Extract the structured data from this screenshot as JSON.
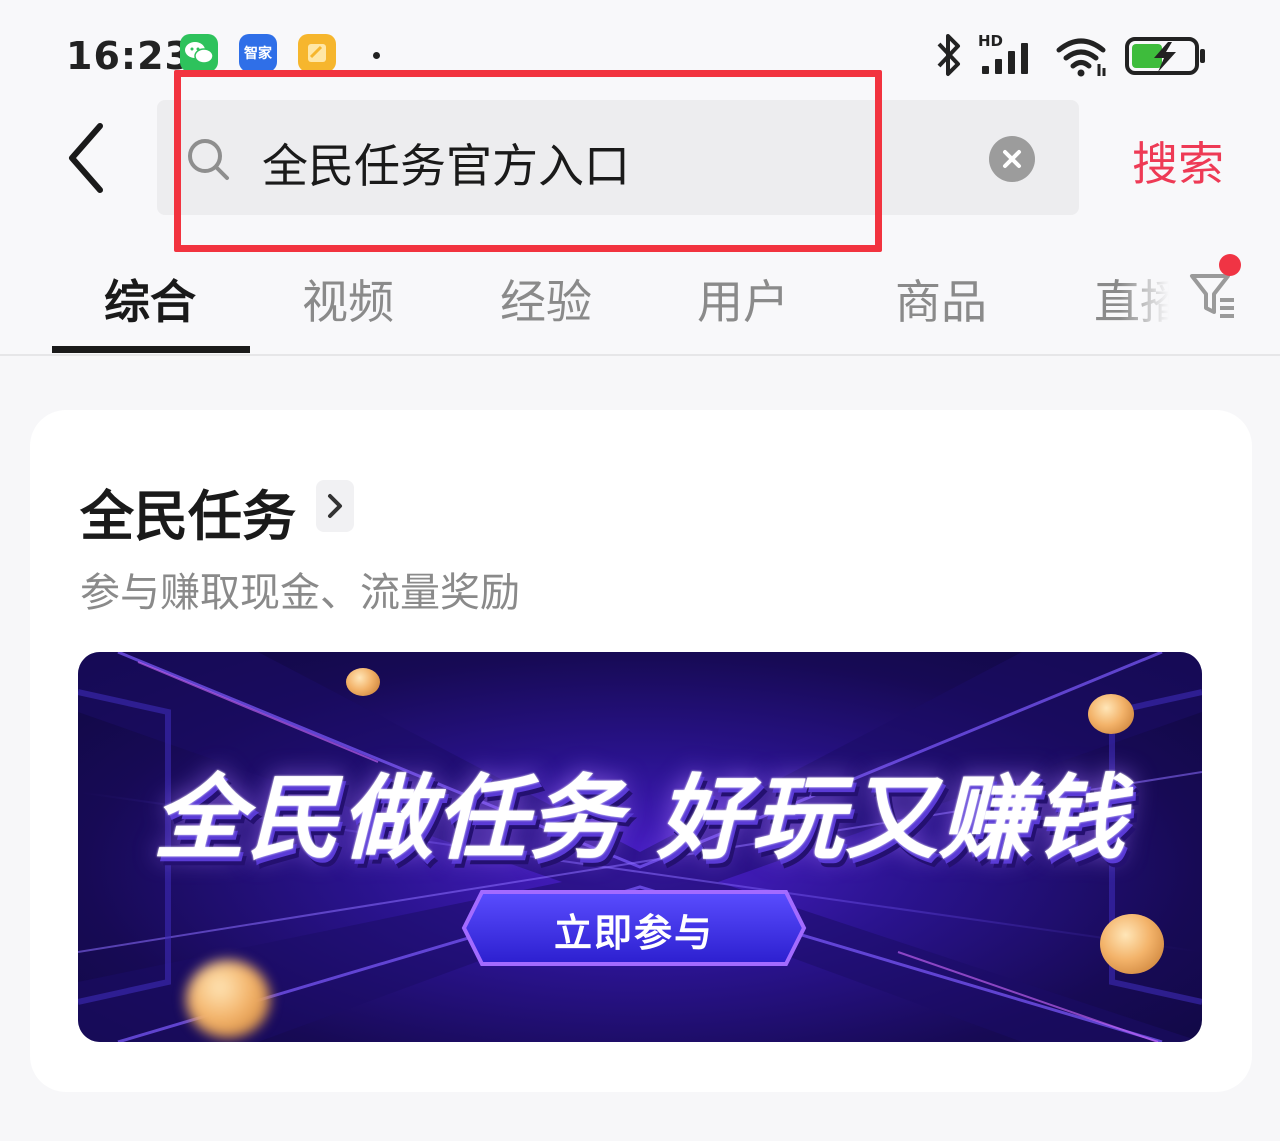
{
  "status_bar": {
    "time": "16:23",
    "apps": [
      {
        "name": "wechat-app-icon",
        "label": "",
        "color": "#2ec25c"
      },
      {
        "name": "zhijia-app-icon",
        "label": "智家",
        "color": "#2f6fe8"
      },
      {
        "name": "notes-app-icon",
        "label": "",
        "color": "#f6b62d"
      }
    ],
    "network_label": "HD",
    "icons": [
      "bluetooth-icon",
      "signal-icon",
      "wifi-icon",
      "battery-charging-icon"
    ]
  },
  "search": {
    "query": "全民任务官方入口",
    "action_label": "搜索",
    "action_color": "#ee3a55",
    "highlight_color": "#f2333f"
  },
  "tabs": [
    {
      "label": "综合",
      "active": true
    },
    {
      "label": "视频",
      "active": false
    },
    {
      "label": "经验",
      "active": false
    },
    {
      "label": "用户",
      "active": false
    },
    {
      "label": "商品",
      "active": false
    },
    {
      "label": "直播",
      "active": false
    }
  ],
  "card": {
    "title": "全民任务",
    "subtitle": "参与赚取现金、流量奖励",
    "banner": {
      "headline": "全民做任务 好玩又赚钱",
      "cta": "立即参与",
      "colors": {
        "bg_dark": "#170a55",
        "bg_mid": "#4a1fc9",
        "cta": "#3d33e6",
        "cta_border": "#a36bff"
      }
    }
  }
}
